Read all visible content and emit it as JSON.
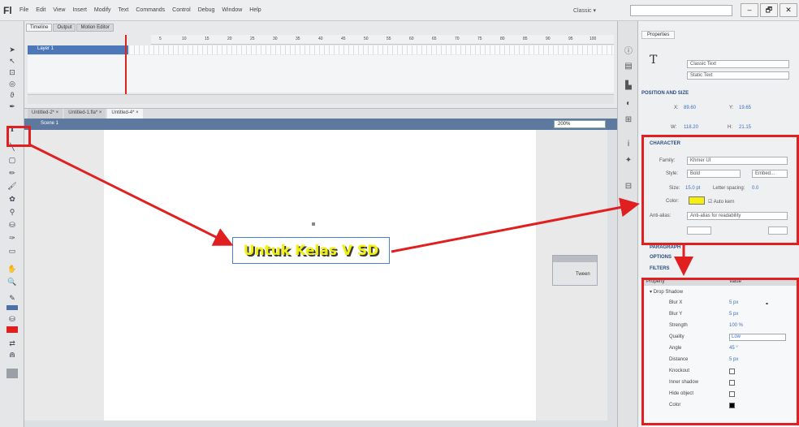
{
  "app": {
    "logo": "Fl",
    "menus": [
      "File",
      "Edit",
      "View",
      "Insert",
      "Modify",
      "Text",
      "Commands",
      "Control",
      "Debug",
      "Window",
      "Help"
    ],
    "workspace": "Classic ▾",
    "window_buttons": [
      "–",
      "🗗",
      "✕"
    ]
  },
  "timeline": {
    "tabs": [
      "Timeline",
      "Output",
      "Motion Editor"
    ],
    "ruler_ticks": [
      "5",
      "10",
      "15",
      "20",
      "25",
      "30",
      "35",
      "40",
      "45",
      "50",
      "55",
      "60",
      "65",
      "70",
      "75",
      "80",
      "85",
      "90",
      "95",
      "100"
    ],
    "layer_name": "Layer 1"
  },
  "document_tabs": [
    "Untitled-2* ×",
    "Untitled-1.fla* ×",
    "Untitled-4* ×"
  ],
  "scene": {
    "name": "Scene 1",
    "zoom": "200%"
  },
  "stage": {
    "text": "Untuk Kelas V SD",
    "tween_label": "Tween"
  },
  "properties": {
    "tab": "Properties",
    "text_engine": "Classic Text",
    "text_type": "Static Text",
    "sections": {
      "position": "POSITION AND SIZE",
      "character": "CHARACTER",
      "paragraph": "PARAGRAPH",
      "options": "OPTIONS",
      "filters": "FILTERS"
    },
    "position": {
      "x": "89.60",
      "y": "19.65",
      "w": "118.20",
      "h": "21.15"
    },
    "character": {
      "family_label": "Family:",
      "family": "Khmer UI",
      "style_label": "Style:",
      "style": "Bold",
      "embed_label": "Embed...",
      "size_label": "Size:",
      "size": "15.0 pt",
      "letter_spacing_label": "Letter spacing:",
      "letter_spacing": "0.0",
      "color_label": "Color:",
      "color": "#f5f010",
      "auto_kern": "Auto kern",
      "anti_alias_label": "Anti-alias:",
      "anti_alias": "Anti-alias for readability"
    },
    "filters": {
      "col_property": "Property",
      "col_value": "Value",
      "group": "Drop Shadow",
      "rows": [
        {
          "name": "Blur X",
          "value": "5 px"
        },
        {
          "name": "Blur Y",
          "value": "5 px"
        },
        {
          "name": "Strength",
          "value": "100 %"
        },
        {
          "name": "Quality",
          "value": "Low"
        },
        {
          "name": "Angle",
          "value": "45 °"
        },
        {
          "name": "Distance",
          "value": "5 px"
        },
        {
          "name": "Knockout",
          "value": ""
        },
        {
          "name": "Inner shadow",
          "value": ""
        },
        {
          "name": "Hide object",
          "value": ""
        },
        {
          "name": "Color",
          "value": ""
        }
      ],
      "shadow_color": "#000000"
    }
  },
  "highlight_color": "#e02020"
}
